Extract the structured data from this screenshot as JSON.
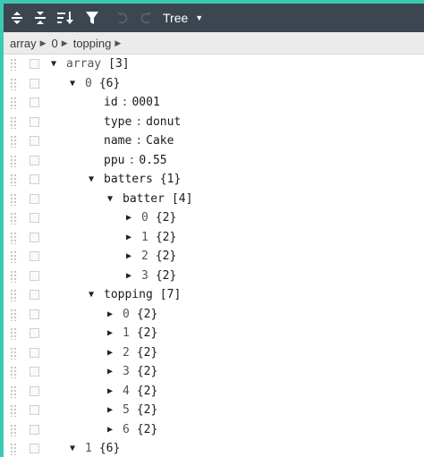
{
  "toolbar": {
    "buttons": [
      {
        "name": "expand-all-icon",
        "enabled": true
      },
      {
        "name": "collapse-all-icon",
        "enabled": true
      },
      {
        "name": "sort-icon",
        "enabled": true
      },
      {
        "name": "filter-icon",
        "enabled": true
      },
      {
        "name": "undo-icon",
        "enabled": false
      },
      {
        "name": "redo-icon",
        "enabled": false
      }
    ],
    "mode": "Tree"
  },
  "breadcrumb": [
    "array",
    "0",
    "topping"
  ],
  "tree": [
    {
      "depth": 0,
      "toggle": "▼",
      "key": "array",
      "info": "[3]",
      "sep": "",
      "value": "",
      "muted": true
    },
    {
      "depth": 1,
      "toggle": "▼",
      "key": "0",
      "info": "{6}",
      "sep": "",
      "value": "",
      "muted": true
    },
    {
      "depth": 2,
      "toggle": "",
      "key": "id",
      "info": "",
      "sep": ":",
      "value": "0001"
    },
    {
      "depth": 2,
      "toggle": "",
      "key": "type",
      "info": "",
      "sep": ":",
      "value": "donut"
    },
    {
      "depth": 2,
      "toggle": "",
      "key": "name",
      "info": "",
      "sep": ":",
      "value": "Cake"
    },
    {
      "depth": 2,
      "toggle": "",
      "key": "ppu",
      "info": "",
      "sep": ":",
      "value": "0.55"
    },
    {
      "depth": 2,
      "toggle": "▼",
      "key": "batters",
      "info": "{1}",
      "sep": "",
      "value": ""
    },
    {
      "depth": 3,
      "toggle": "▼",
      "key": "batter",
      "info": "[4]",
      "sep": "",
      "value": ""
    },
    {
      "depth": 4,
      "toggle": "▶",
      "key": "0",
      "info": "{2}",
      "sep": "",
      "value": "",
      "muted": true
    },
    {
      "depth": 4,
      "toggle": "▶",
      "key": "1",
      "info": "{2}",
      "sep": "",
      "value": "",
      "muted": true
    },
    {
      "depth": 4,
      "toggle": "▶",
      "key": "2",
      "info": "{2}",
      "sep": "",
      "value": "",
      "muted": true
    },
    {
      "depth": 4,
      "toggle": "▶",
      "key": "3",
      "info": "{2}",
      "sep": "",
      "value": "",
      "muted": true
    },
    {
      "depth": 2,
      "toggle": "▼",
      "key": "topping",
      "info": "[7]",
      "sep": "",
      "value": ""
    },
    {
      "depth": 3,
      "toggle": "▶",
      "key": "0",
      "info": "{2}",
      "sep": "",
      "value": "",
      "muted": true
    },
    {
      "depth": 3,
      "toggle": "▶",
      "key": "1",
      "info": "{2}",
      "sep": "",
      "value": "",
      "muted": true
    },
    {
      "depth": 3,
      "toggle": "▶",
      "key": "2",
      "info": "{2}",
      "sep": "",
      "value": "",
      "muted": true
    },
    {
      "depth": 3,
      "toggle": "▶",
      "key": "3",
      "info": "{2}",
      "sep": "",
      "value": "",
      "muted": true
    },
    {
      "depth": 3,
      "toggle": "▶",
      "key": "4",
      "info": "{2}",
      "sep": "",
      "value": "",
      "muted": true
    },
    {
      "depth": 3,
      "toggle": "▶",
      "key": "5",
      "info": "{2}",
      "sep": "",
      "value": "",
      "muted": true
    },
    {
      "depth": 3,
      "toggle": "▶",
      "key": "6",
      "info": "{2}",
      "sep": "",
      "value": "",
      "muted": true
    },
    {
      "depth": 1,
      "toggle": "▼",
      "key": "1",
      "info": "{6}",
      "sep": "",
      "value": "",
      "muted": true
    }
  ],
  "colors": {
    "accent": "#3dc9b0",
    "toolbar": "#3c4650",
    "navbar": "#ebebeb"
  }
}
